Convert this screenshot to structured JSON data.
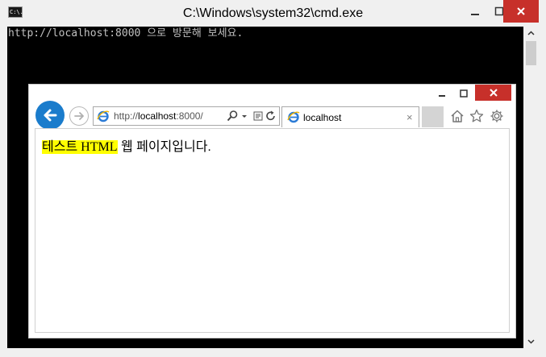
{
  "cmd": {
    "title": "C:\\Windows\\system32\\cmd.exe",
    "icon_text": "C:\\.",
    "console_line": "http://localhost:8000 으로 방문해 보세요."
  },
  "ie": {
    "address": {
      "prefix": "http://",
      "host": "localhost",
      "suffix": ":8000/"
    },
    "tab": {
      "title": "localhost",
      "close_glyph": "×"
    },
    "page": {
      "highlight_text": "테스트 HTML",
      "rest_text": " 웹 페이지입니다."
    }
  },
  "colors": {
    "close_red": "#c7302a",
    "ie_blue": "#1a7ccc",
    "highlight": "#ffff00",
    "console_bg": "#000000",
    "console_text": "#c0c0c0"
  }
}
